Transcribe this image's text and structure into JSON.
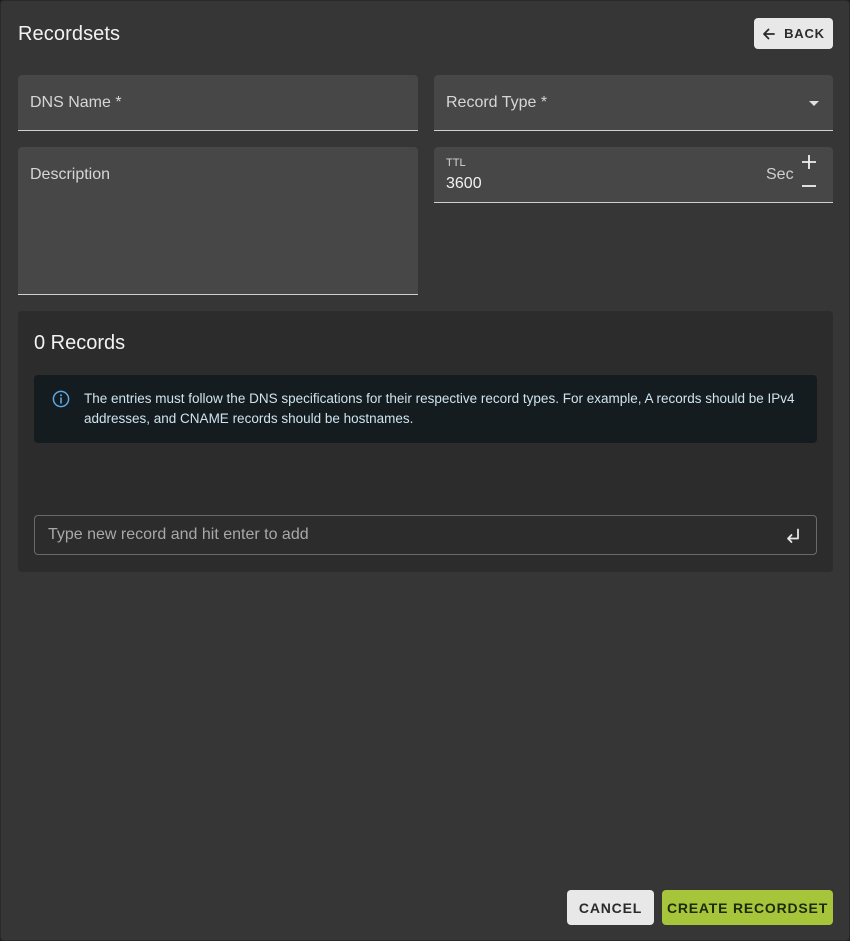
{
  "dialog": {
    "title": "Recordsets",
    "back_label": "BACK"
  },
  "form": {
    "dns_name_label": "DNS Name *",
    "record_type_label": "Record Type *",
    "description_label": "Description",
    "ttl_label": "TTL",
    "ttl_value": "3600",
    "ttl_unit": "Sec"
  },
  "records": {
    "count_label": "0 Records",
    "info_text": "The entries must follow the DNS specifications for their respective record types. For example, A records should be IPv4 addresses, and CNAME records should be hostnames.",
    "input_placeholder": "Type new record and hit enter to add"
  },
  "footer": {
    "cancel_label": "CANCEL",
    "create_label": "CREATE RECORDSET"
  },
  "colors": {
    "accent": "#a6c53a",
    "info_icon": "#5aa9e6"
  },
  "icons": [
    "arrow-left-icon",
    "chevron-down-icon",
    "plus-icon",
    "minus-icon",
    "info-icon",
    "enter-icon"
  ]
}
